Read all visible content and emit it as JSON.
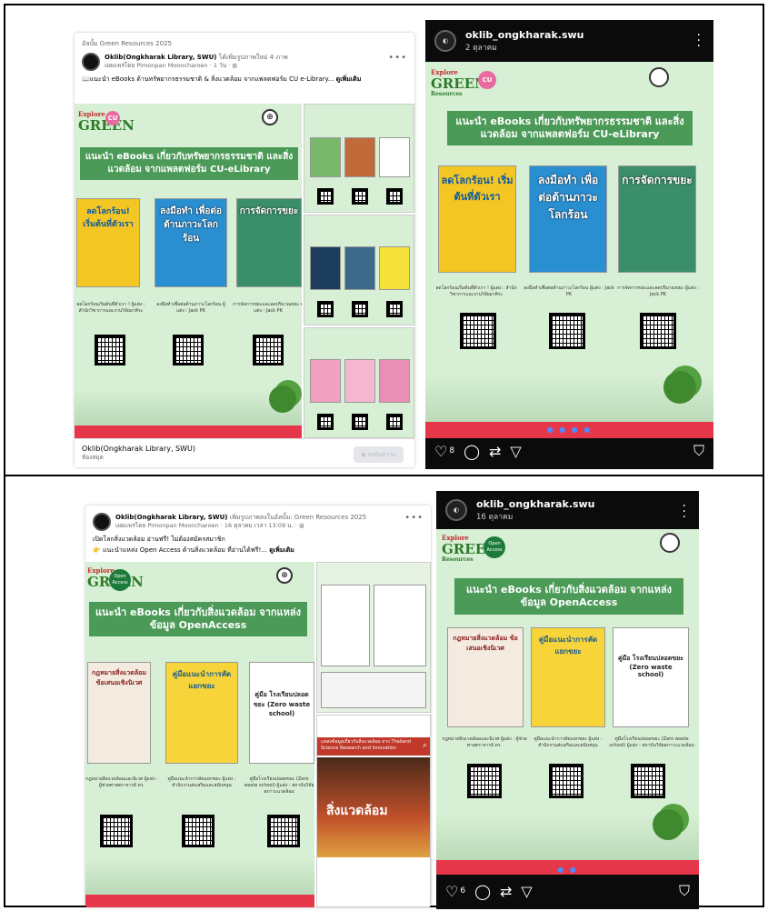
{
  "fb1": {
    "album": "อัลบั้ม Green Resources 2025",
    "author": "Oklib(Ongkharak Library, SWU)",
    "action": "ได้เพิ่มรูปภาพใหม่ 4 ภาพ",
    "poster_by": "เผยแพร่โดย Pimonpan Mooncharoen",
    "time": "1 วัน",
    "text": "แนะนำ eBooks ด้านทรัพยากรธรรมชาติ & สิ่งแวดล้อม จากแพลตฟอร์ม CU e-Library...",
    "see_more": "ดูเพิ่มเติม",
    "footer_name": "Oklib(Ongkharak Library, SWU)",
    "footer_sub": "ห้องสมุด",
    "message_btn": "ส่งข้อความ"
  },
  "fb2": {
    "author": "Oklib(Ongkharak Library, SWU)",
    "action": "เพิ่มรูปภาพลงในอัลบั้ม: Green Resources 2025",
    "poster_by": "เผยแพร่โดย Pimonpan Mooncharoen",
    "time": "16 ตุลาคม เวลา 13:09 น.",
    "text1": "เปิดโลกสิ่งแวดล้อม อ่านฟรี! ไม่ต้องสมัครสมาชิก",
    "text2": "แนะนำแหล่ง Open Access ด้านสิ่งแวดล้อม ที่อ่านได้ฟรี!...",
    "see_more": "ดูเพิ่มเติม"
  },
  "ig1": {
    "username": "oklib_ongkharak.swu",
    "date": "2 ตุลาคม",
    "likes": "8",
    "dots": "● ● ● ●"
  },
  "ig2": {
    "username": "oklib_ongkharak.swu",
    "date": "16 ตุลาคม",
    "likes": "6",
    "dots": "● ●"
  },
  "poster1": {
    "logo_explore": "Explore",
    "logo_green": "GREEN",
    "logo_resources": "Resources",
    "cu": "CU",
    "banner": "แนะนำ eBooks เกี่ยวกับทรัพยากรธรรมชาติ และสิ่งแวดล้อม จากแพลตฟอร์ม CU-eLibrary",
    "books": [
      {
        "title": "ลดโลกร้อน! เริ่มต้นที่ตัวเรา",
        "cap": "ลดโลกร้อนเริ่มต้นที่ตัวเรา ! ผู้แต่ง : สำนักวิชาการและงานวิจัยอาคิระ",
        "color": "#f3c623"
      },
      {
        "title": "ลงมือทำ เพื่อต่อต้านภาวะโลกร้อน",
        "cap": "ลงมือทำเพื่อต่อต้านภาวะโลกร้อน ผู้แต่ง : Jack PK",
        "color": "#2a8fd1"
      },
      {
        "title": "การจัดการขยะ",
        "cap": "การจัดการขยะและลดปริมาณขยะ ผู้แต่ง : Jack PK",
        "color": "#3a8f6a"
      }
    ]
  },
  "poster2": {
    "logo_explore": "Explore",
    "logo_green": "GREEN",
    "logo_resources": "Resources",
    "oa": "Open Access",
    "banner": "แนะนำ eBooks เกี่ยวกับสิ่งแวดล้อม จากแหล่งข้อมูล OpenAccess",
    "books": [
      {
        "title": "กฎหมายสิ่งแวดล้อม ข้อเสนอเชิงนิเวศ",
        "cap": "กฎหมายสิ่งแวดล้อมและนิเวศ ผู้แต่ง : ผู้ช่วยศาสตราจารย์ ดร.",
        "color": "#f3ebe0"
      },
      {
        "title": "คู่มือแนะนำการคัดแยกขยะ",
        "cap": "คู่มือแนะนำการคัดแยกขยะ ผู้แต่ง : สำนักงานส่งเสริมและสนับสนุน",
        "color": "#f6d43a"
      },
      {
        "title": "คู่มือ โรงเรียนปลอดขยะ (Zero waste school)",
        "cap": "คู่มือโรงเรียนปลอดขยะ (Zero waste school) ผู้แต่ง : สถาบันวิจัยสภาวะแวดล้อม",
        "color": "#ffffff"
      }
    ],
    "yt_title": "แหล่งข้อมูลเกี่ยวกับสิ่งแวดล้อม จาก Thailand Science Research and Innovation",
    "yt_big": "สิ่งแวดล้อม"
  }
}
